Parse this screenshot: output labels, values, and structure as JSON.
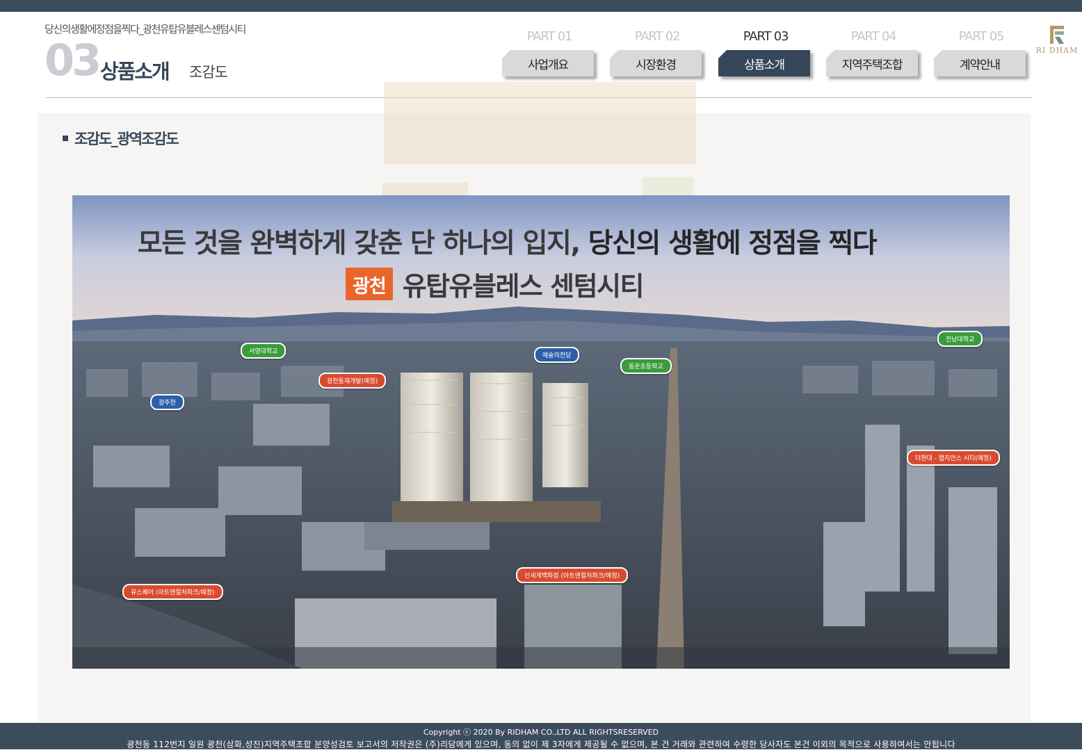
{
  "header": {
    "tagline": "당신의생활에정점을찍다_광천유탑유블레스센텀시티",
    "section_number": "03",
    "section_title": "상품소개",
    "section_subtitle": "조감도"
  },
  "nav": [
    {
      "part": "PART 01",
      "label": "사업개요",
      "active": false
    },
    {
      "part": "PART 02",
      "label": "시장환경",
      "active": false
    },
    {
      "part": "PART 03",
      "label": "상품소개",
      "active": true
    },
    {
      "part": "PART 04",
      "label": "지역주택조합",
      "active": false
    },
    {
      "part": "PART 05",
      "label": "계약안내",
      "active": false
    }
  ],
  "logo": {
    "text": "RI DHAM"
  },
  "content": {
    "bullet_title": "조감도_광역조감도"
  },
  "image": {
    "headline_part1": "모든 것을 완벽하게 갖춘 단 하나의 입지,",
    "headline_part2": "당신의 생활에 정점을 찍다",
    "badge": "광천",
    "project_name": "유탑유블레스 센텀시티",
    "labels": {
      "seomyeong": "서영대학교",
      "gwangcheon_redev": "광천동재개발(예정)",
      "gwangjucheon": "광주천",
      "arts_center": "예술의전당",
      "dongun_school": "동운초등학교",
      "chonnam_univ": "전남대학교",
      "lifestyle_city": "더현대 - 랩지언스 시티(예정)",
      "shinsegae": "신세계백화점 (아트앤컬처파크/예정)",
      "usquare": "유스퀘어 (아트앤컬처파크/예정)"
    }
  },
  "footer": {
    "copyright": "Copyright ⓒ 2020 By RIDHAM CO.,LTD ALL RIGHTSRESERVED",
    "notice": "광천동 112번지 일원 광천(삼화,성진)지역주택조합 분양성검토 보고서의 저작권은 (주)리담에게 있으며, 동의 없이 제 3자에게 제공될 수 없으며, 본 건 거래와 관련하여 수령한 당사자도 본건 이외의 목적으로 사용하여서는 안됩니다"
  },
  "colors": {
    "brand_navy": "#37475a",
    "bar": "#3c4c5b",
    "accent_orange": "#e8662a",
    "logo_gold": "#b79a62"
  }
}
